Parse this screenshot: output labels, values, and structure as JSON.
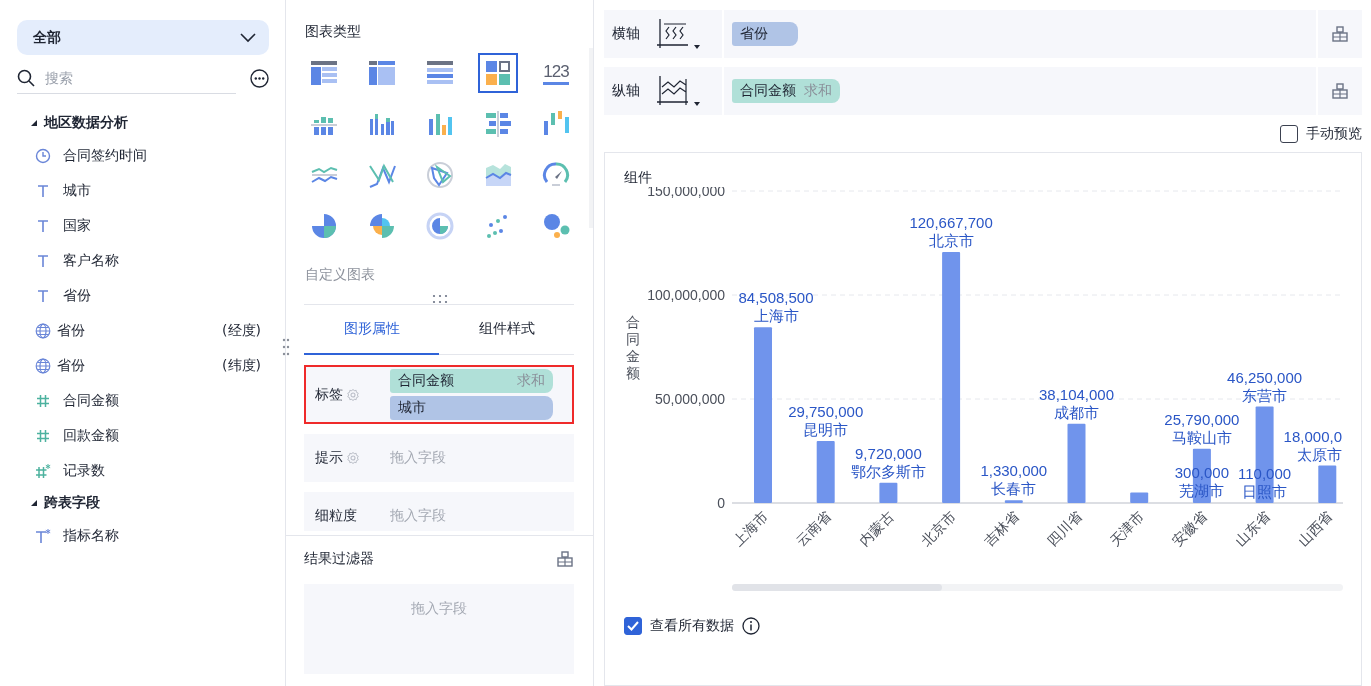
{
  "field_panel": {
    "scope": "全部",
    "search_placeholder": "搜索",
    "groups": [
      {
        "name": "地区数据分析",
        "expanded": true,
        "children": [
          {
            "kind": "date",
            "name": "合同签约时间"
          },
          {
            "kind": "text",
            "name": "城市"
          },
          {
            "kind": "text",
            "name": "国家"
          },
          {
            "kind": "text",
            "name": "客户名称"
          },
          {
            "kind": "text",
            "name": "省份"
          },
          {
            "kind": "geo",
            "name": "省份",
            "suffix": "(经度)"
          },
          {
            "kind": "geo",
            "name": "省份",
            "suffix": "(纬度)"
          },
          {
            "kind": "number",
            "name": "合同金额"
          },
          {
            "kind": "number",
            "name": "回款金额"
          },
          {
            "kind": "calc-number",
            "name": "记录数"
          }
        ]
      },
      {
        "name": "跨表字段",
        "expanded": true,
        "children": [
          {
            "kind": "calc-text",
            "name": "指标名称"
          }
        ]
      }
    ]
  },
  "chart_type_panel": {
    "title": "图表类型",
    "types": [
      {
        "kind": "table",
        "selected": false
      },
      {
        "kind": "crosstab",
        "selected": false
      },
      {
        "kind": "detail",
        "selected": false
      },
      {
        "kind": "dashboard",
        "selected": true
      },
      {
        "kind": "number",
        "text": "123",
        "selected": false
      },
      {
        "kind": "stacked-bar",
        "selected": false
      },
      {
        "kind": "grouped-bar",
        "selected": false
      },
      {
        "kind": "bar",
        "selected": false
      },
      {
        "kind": "hbar",
        "selected": false
      },
      {
        "kind": "range",
        "selected": false
      },
      {
        "kind": "line",
        "selected": false
      },
      {
        "kind": "multiline",
        "selected": false
      },
      {
        "kind": "radar",
        "selected": false
      },
      {
        "kind": "area",
        "selected": false
      },
      {
        "kind": "gauge",
        "selected": false
      },
      {
        "kind": "pie",
        "selected": false
      },
      {
        "kind": "rose",
        "selected": false
      },
      {
        "kind": "ring",
        "selected": false
      },
      {
        "kind": "scatter",
        "selected": false
      },
      {
        "kind": "bubble",
        "selected": false
      }
    ],
    "custom": "自定义图表"
  },
  "property_tabs": [
    {
      "label": "图形属性",
      "selected": true
    },
    {
      "label": "组件样式",
      "selected": false
    }
  ],
  "properties": [
    {
      "label": "标签",
      "settings": true,
      "highlighted": true,
      "fields": [
        {
          "kind": "measure",
          "name": "合同金额",
          "aggregation": "求和"
        },
        {
          "kind": "dimension",
          "name": "城市"
        }
      ]
    },
    {
      "label": "提示",
      "settings": true,
      "highlighted": false,
      "placeholder": "拖入字段"
    },
    {
      "label": "细粒度",
      "settings": false,
      "highlighted": false,
      "placeholder": "拖入字段"
    }
  ],
  "result_filter": {
    "title": "结果过滤器",
    "placeholder": "拖入字段"
  },
  "axes": [
    {
      "label": "横轴",
      "kind": "x",
      "fields": [
        {
          "kind": "dimension",
          "name": "省份"
        }
      ]
    },
    {
      "label": "纵轴",
      "kind": "y",
      "fields": [
        {
          "kind": "measure",
          "name": "合同金额",
          "aggregation": "求和"
        }
      ]
    }
  ],
  "manual_preview": {
    "label": "手动预览",
    "checked": false
  },
  "chart": {
    "title": "组件",
    "show_all": {
      "label": "查看所有数据",
      "checked": true
    },
    "chart_data": {
      "type": "bar",
      "ylabel": "合同金额",
      "categories": [
        "上海市",
        "云南省",
        "内蒙古",
        "北京市",
        "吉林省",
        "四川省",
        "天津市",
        "安徽省",
        "山东省",
        "山西省"
      ],
      "series": [
        {
          "color": "#7094ec",
          "values": [
            84508500,
            29750000,
            9720000,
            120667700,
            1330000,
            38104000,
            5000000,
            26090000,
            46360000,
            18000000
          ]
        }
      ],
      "ylim": [
        0,
        150000000
      ],
      "yticks": [
        {
          "value": 0,
          "label": "0"
        },
        {
          "value": 50000000,
          "label": "50,000,000"
        },
        {
          "value": 100000000,
          "label": "100,000,000"
        },
        {
          "value": 150000000,
          "label": "150,000,000"
        }
      ],
      "annotations": [
        {
          "x": "上海市",
          "y": 84508500,
          "text": "84,508,500"
        },
        {
          "x": "上海市",
          "y": 84508500,
          "text": "上海市"
        },
        {
          "x": "云南省",
          "y": 29750000,
          "text": "29,750,000"
        },
        {
          "x": "云南省",
          "y": 29750000,
          "text": "昆明市"
        },
        {
          "x": "内蒙古",
          "y": 9720000,
          "text": "9,720,000"
        },
        {
          "x": "内蒙古",
          "y": 9720000,
          "text": "鄂尔多斯市"
        },
        {
          "x": "北京市",
          "y": 120667700,
          "text": "120,667,700"
        },
        {
          "x": "北京市",
          "y": 120667700,
          "text": "北京市"
        },
        {
          "x": "吉林省",
          "y": 1330000,
          "text": "1,330,000"
        },
        {
          "x": "吉林省",
          "y": 1330000,
          "text": "长春市"
        },
        {
          "x": "四川省",
          "y": 38104000,
          "text": "38,104,000"
        },
        {
          "x": "四川省",
          "y": 38104000,
          "text": "成都市"
        },
        {
          "x": "安徽省",
          "y": 26090000,
          "text": "25,790,000"
        },
        {
          "x": "安徽省",
          "y": 26090000,
          "text": "马鞍山市"
        },
        {
          "x": "安徽省",
          "y": 300000,
          "text": "300,000"
        },
        {
          "x": "安徽省",
          "y": 300000,
          "text": "芜湖市"
        },
        {
          "x": "山东省",
          "y": 46360000,
          "text": "46,250,000"
        },
        {
          "x": "山东省",
          "y": 46360000,
          "text": "东营市"
        },
        {
          "x": "山东省",
          "y": 110000,
          "text": "110,000"
        },
        {
          "x": "山东省",
          "y": 110000,
          "text": "日照市"
        },
        {
          "x": "山西省",
          "y": 18000000,
          "text": "18,000,0"
        },
        {
          "x": "山西省",
          "y": 18000000,
          "text": "太原市"
        }
      ]
    }
  }
}
